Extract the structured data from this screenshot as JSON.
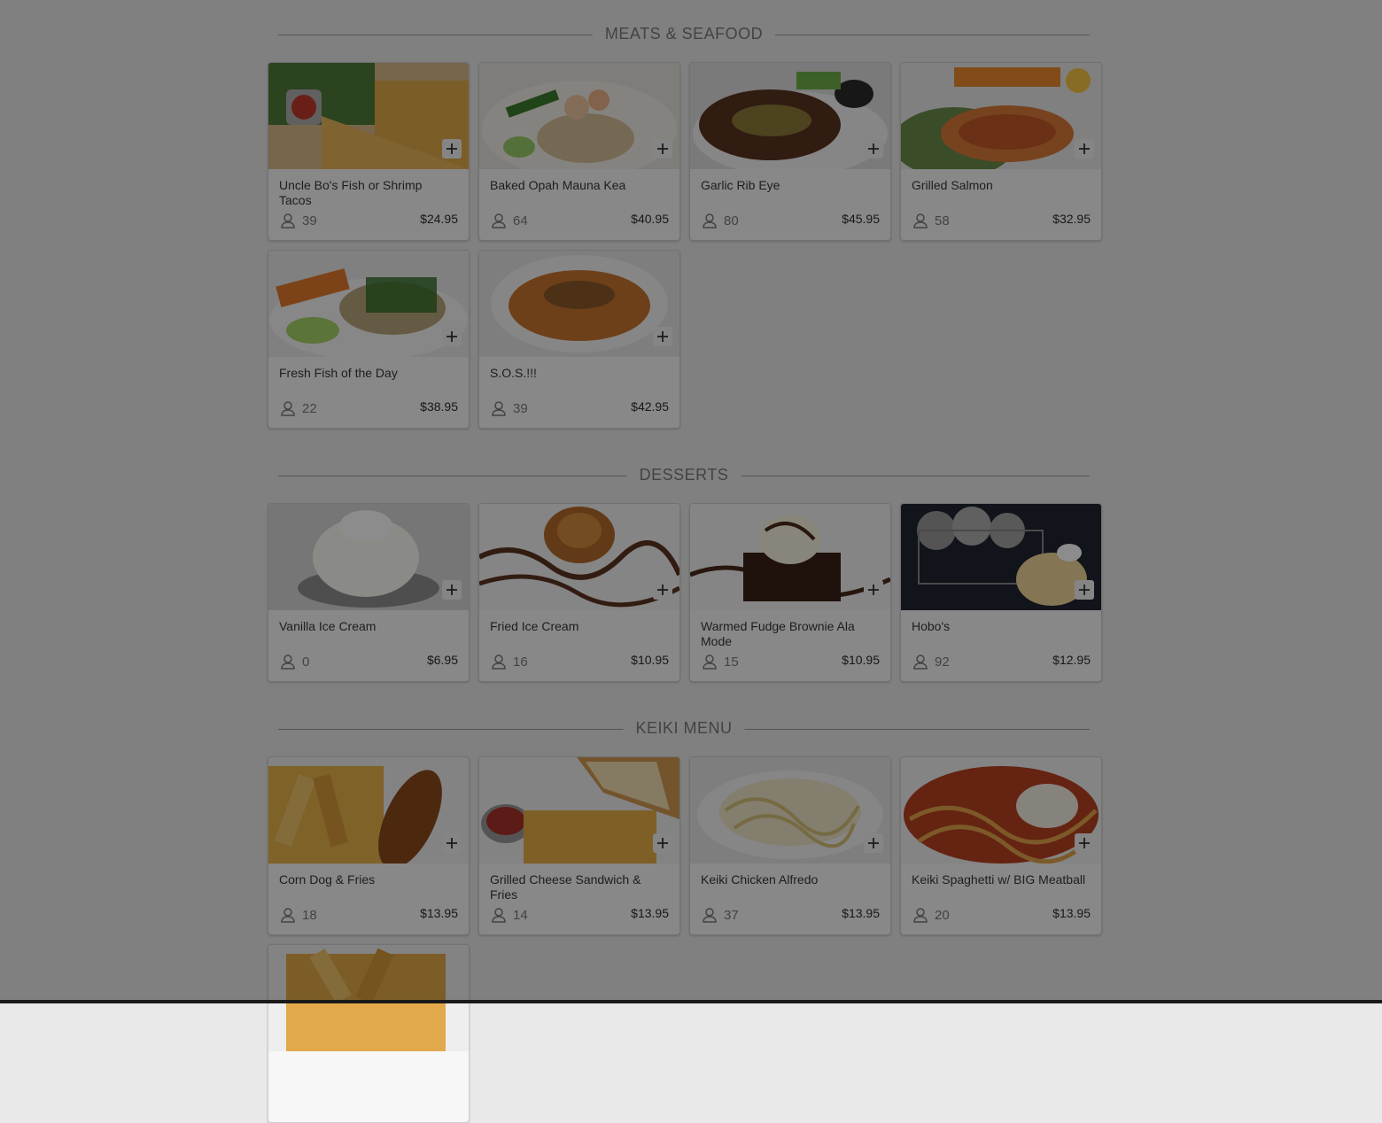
{
  "sections": [
    {
      "title": "MEATS & SEAFOOD",
      "items": [
        {
          "name": "Uncle Bo's Fish or Shrimp Tacos",
          "count": "39",
          "price": "$24.95",
          "photo": "tacos"
        },
        {
          "name": "Baked Opah Mauna Kea",
          "count": "64",
          "price": "$40.95",
          "photo": "opah"
        },
        {
          "name": "Garlic Rib Eye",
          "count": "80",
          "price": "$45.95",
          "photo": "ribeye"
        },
        {
          "name": "Grilled Salmon",
          "count": "58",
          "price": "$32.95",
          "photo": "salmon"
        },
        {
          "name": "Fresh Fish of the Day",
          "count": "22",
          "price": "$38.95",
          "photo": "fish"
        },
        {
          "name": "S.O.S.!!!",
          "count": "39",
          "price": "$42.95",
          "photo": "sos"
        }
      ]
    },
    {
      "title": "DESSERTS",
      "items": [
        {
          "name": "Vanilla Ice Cream",
          "count": "0",
          "price": "$6.95",
          "photo": "icecream"
        },
        {
          "name": "Fried Ice Cream",
          "count": "16",
          "price": "$10.95",
          "photo": "friedicecream"
        },
        {
          "name": "Warmed Fudge Brownie Ala Mode",
          "count": "15",
          "price": "$10.95",
          "photo": "brownie"
        },
        {
          "name": "Hobo's",
          "count": "92",
          "price": "$12.95",
          "photo": "hobos"
        }
      ]
    },
    {
      "title": "KEIKI MENU",
      "items": [
        {
          "name": "Corn Dog & Fries",
          "count": "18",
          "price": "$13.95",
          "photo": "corndog"
        },
        {
          "name": "Grilled Cheese Sandwich & Fries",
          "count": "14",
          "price": "$13.95",
          "photo": "grilledcheese"
        },
        {
          "name": "Keiki Chicken Alfredo",
          "count": "37",
          "price": "$13.95",
          "photo": "alfredo"
        },
        {
          "name": "Keiki Spaghetti w/ BIG Meatball",
          "count": "20",
          "price": "$13.95",
          "photo": "spaghetti"
        },
        {
          "name": "",
          "count": "",
          "price": "",
          "photo": "fries"
        }
      ]
    }
  ],
  "icons": {
    "add": "plus-icon",
    "people": "person-icon"
  },
  "colors": {
    "overlay": "#000000",
    "card_bg": "#f7f7f7"
  }
}
